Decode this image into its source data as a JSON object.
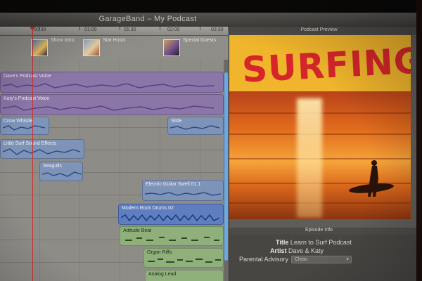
{
  "window": {
    "title": "GarageBand – My Podcast"
  },
  "ruler": {
    "ticks": [
      "00:30",
      "01:00",
      "01:30",
      "02:00",
      "02:30"
    ]
  },
  "markers": [
    {
      "label": "Show Intro",
      "color": "#4a79b8"
    },
    {
      "label": "Star Hosts",
      "color": "#8aa7c9"
    },
    {
      "label": "Special Guests",
      "color": "#c9a060"
    }
  ],
  "tracks": {
    "regions": [
      {
        "name": "Dave's Podcast Voice",
        "color": "purple"
      },
      {
        "name": "Katy's Podcast Voice",
        "color": "purple"
      },
      {
        "name": "Crow Whistle",
        "color": "blue"
      },
      {
        "name": "Slide",
        "color": "blue"
      },
      {
        "name": "Little Surf Sound Effects",
        "color": "blue"
      },
      {
        "name": "Seagulls",
        "color": "blue"
      },
      {
        "name": "Electric Guitar Swell 01.1",
        "color": "blue"
      },
      {
        "name": "Modern Rock Drums 02",
        "color": "blue-sel"
      },
      {
        "name": "Attitude Beat",
        "color": "green"
      },
      {
        "name": "Organ Riffs",
        "color": "green"
      },
      {
        "name": "Analog Lead",
        "color": "green"
      }
    ]
  },
  "preview": {
    "header": "Podcast Preview",
    "artwork_title": "SURFING"
  },
  "episode_info": {
    "header": "Episode Info",
    "title_label": "Title",
    "title_value": "Learn to Surf Podcast",
    "artist_label": "Artist",
    "artist_value": "Dave & Katy",
    "advisory_label": "Parental Advisory",
    "advisory_value": "Clean"
  }
}
